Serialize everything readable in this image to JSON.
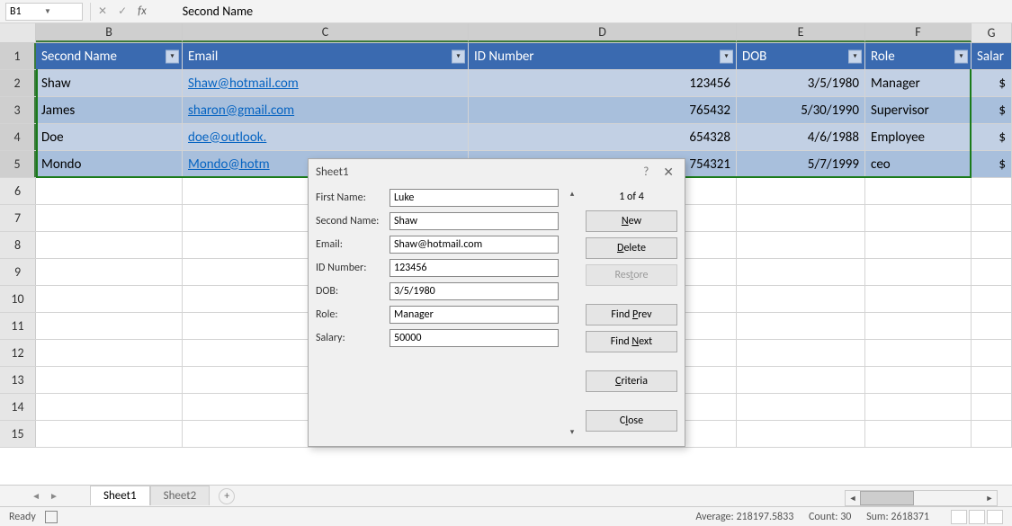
{
  "namebox": {
    "ref": "B1",
    "formula": "Second Name"
  },
  "columns": [
    "B",
    "C",
    "D",
    "E",
    "F",
    "G"
  ],
  "headers": {
    "B": "Second Name",
    "C": "Email",
    "D": "ID Number",
    "E": "DOB",
    "F": "Role",
    "G": "Salar"
  },
  "rows": [
    {
      "n": 2,
      "B": "Shaw",
      "C": "Shaw@hotmail.com",
      "D": "123456",
      "E": "3/5/1980",
      "F": "Manager",
      "G": "$"
    },
    {
      "n": 3,
      "B": "James",
      "C": "sharon@gmail.com",
      "D": "765432",
      "E": "5/30/1990",
      "F": "Supervisor",
      "G": "$"
    },
    {
      "n": 4,
      "B": "Doe",
      "C": "doe@outlook.",
      "D": "654328",
      "E": "4/6/1988",
      "F": "Employee",
      "G": "$"
    },
    {
      "n": 5,
      "B": "Mondo",
      "C": "Mondo@hotm",
      "D": "754321",
      "E": "5/7/1999",
      "F": "ceo",
      "G": "$"
    }
  ],
  "dialog": {
    "title": "Sheet1",
    "counter": "1 of 4",
    "fields": [
      {
        "label": "First Name:",
        "value": "Luke"
      },
      {
        "label": "Second Name:",
        "value": "Shaw"
      },
      {
        "label": "Email:",
        "value": "Shaw@hotmail.com"
      },
      {
        "label": "ID Number:",
        "value": "123456"
      },
      {
        "label": "DOB:",
        "value": "3/5/1980"
      },
      {
        "label": "Role:",
        "value": "Manager"
      },
      {
        "label": "Salary:",
        "value": "50000"
      }
    ],
    "buttons": {
      "new": "New",
      "delete": "Delete",
      "restore": "Restore",
      "findprev": "Find Prev",
      "findnext": "Find Next",
      "criteria": "Criteria",
      "close": "Close"
    }
  },
  "sheets": {
    "active": "Sheet1",
    "other": "Sheet2"
  },
  "status": {
    "state": "Ready",
    "average": "Average: 218197.5833",
    "count": "Count: 30",
    "sum": "Sum: 2618371"
  }
}
